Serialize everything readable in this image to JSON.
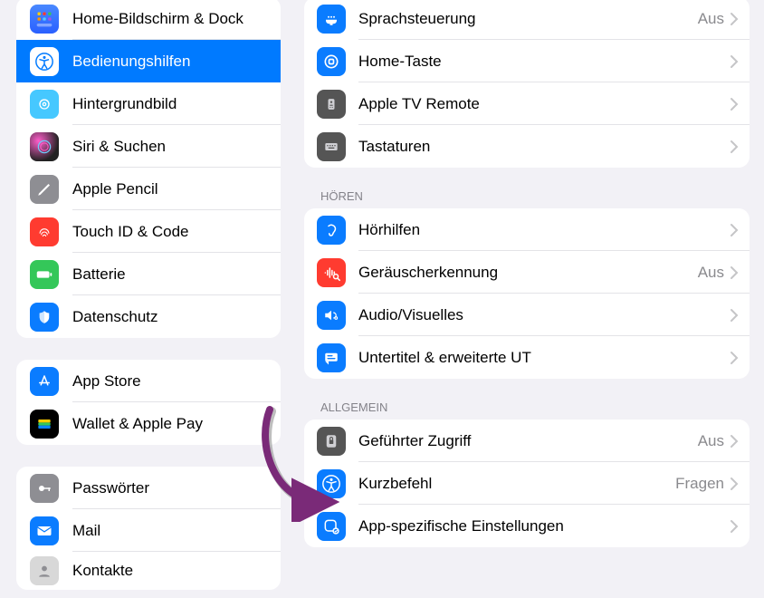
{
  "sidebar": {
    "group1": [
      {
        "id": "home-dock",
        "label": "Home-Bildschirm & Dock"
      },
      {
        "id": "accessibility",
        "label": "Bedienungshilfen",
        "selected": true
      },
      {
        "id": "wallpaper",
        "label": "Hintergrundbild"
      },
      {
        "id": "siri",
        "label": "Siri & Suchen"
      },
      {
        "id": "pencil",
        "label": "Apple Pencil"
      },
      {
        "id": "touchid",
        "label": "Touch ID & Code"
      },
      {
        "id": "battery",
        "label": "Batterie"
      },
      {
        "id": "privacy",
        "label": "Datenschutz"
      }
    ],
    "group2": [
      {
        "id": "appstore",
        "label": "App Store"
      },
      {
        "id": "wallet",
        "label": "Wallet & Apple Pay"
      }
    ],
    "group3": [
      {
        "id": "passwords",
        "label": "Passwörter"
      },
      {
        "id": "mail",
        "label": "Mail"
      },
      {
        "id": "contacts",
        "label": "Kontakte"
      }
    ]
  },
  "detail": {
    "section1": {
      "rows": [
        {
          "id": "voice-control",
          "label": "Sprachsteuerung",
          "value": "Aus"
        },
        {
          "id": "home-button",
          "label": "Home-Taste",
          "value": ""
        },
        {
          "id": "tv-remote",
          "label": "Apple TV Remote",
          "value": ""
        },
        {
          "id": "keyboards",
          "label": "Tastaturen",
          "value": ""
        }
      ]
    },
    "section2": {
      "header": "HÖREN",
      "rows": [
        {
          "id": "hearing",
          "label": "Hörhilfen",
          "value": ""
        },
        {
          "id": "sound-rec",
          "label": "Geräuscherkennung",
          "value": "Aus"
        },
        {
          "id": "audio-vis",
          "label": "Audio/Visuelles",
          "value": ""
        },
        {
          "id": "subtitles",
          "label": "Untertitel & erweiterte UT",
          "value": ""
        }
      ]
    },
    "section3": {
      "header": "ALLGEMEIN",
      "rows": [
        {
          "id": "guided",
          "label": "Geführter Zugriff",
          "value": "Aus"
        },
        {
          "id": "shortcut",
          "label": "Kurzbefehl",
          "value": "Fragen"
        },
        {
          "id": "per-app",
          "label": "App-spezifische Einstellungen",
          "value": ""
        }
      ]
    }
  }
}
